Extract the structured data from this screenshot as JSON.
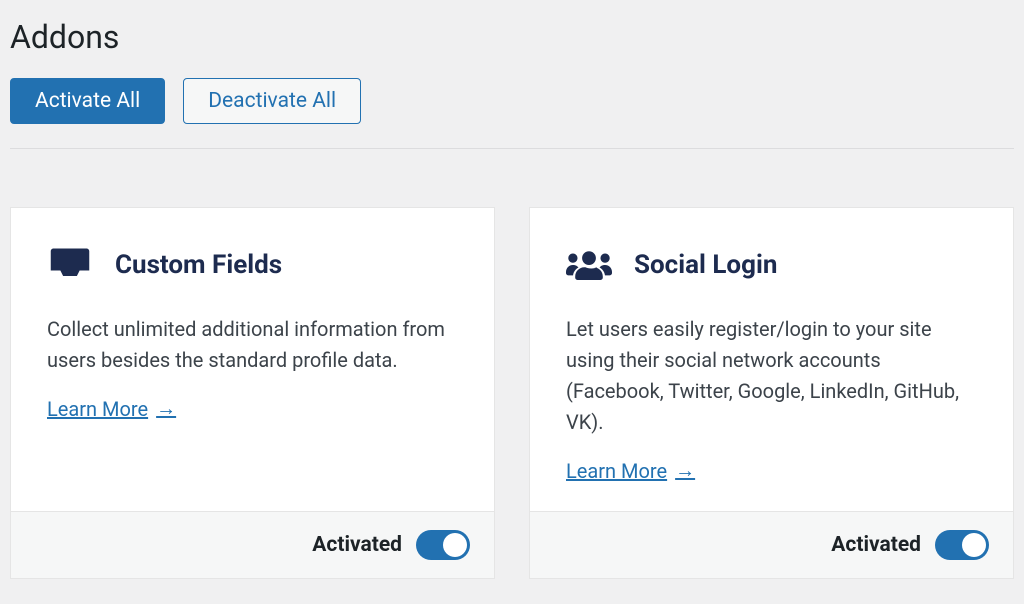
{
  "page_title": "Addons",
  "toolbar": {
    "activate_all": "Activate All",
    "deactivate_all": "Deactivate All"
  },
  "learn_more_label": "Learn More",
  "cards": [
    {
      "title": "Custom Fields",
      "description": "Collect unlimited additional information from users besides the standard profile data.",
      "status": "Activated",
      "active": true
    },
    {
      "title": "Social Login",
      "description": "Let users easily register/login to your site using their social network accounts (Facebook, Twitter, Google, LinkedIn, GitHub, VK).",
      "status": "Activated",
      "active": true
    }
  ]
}
